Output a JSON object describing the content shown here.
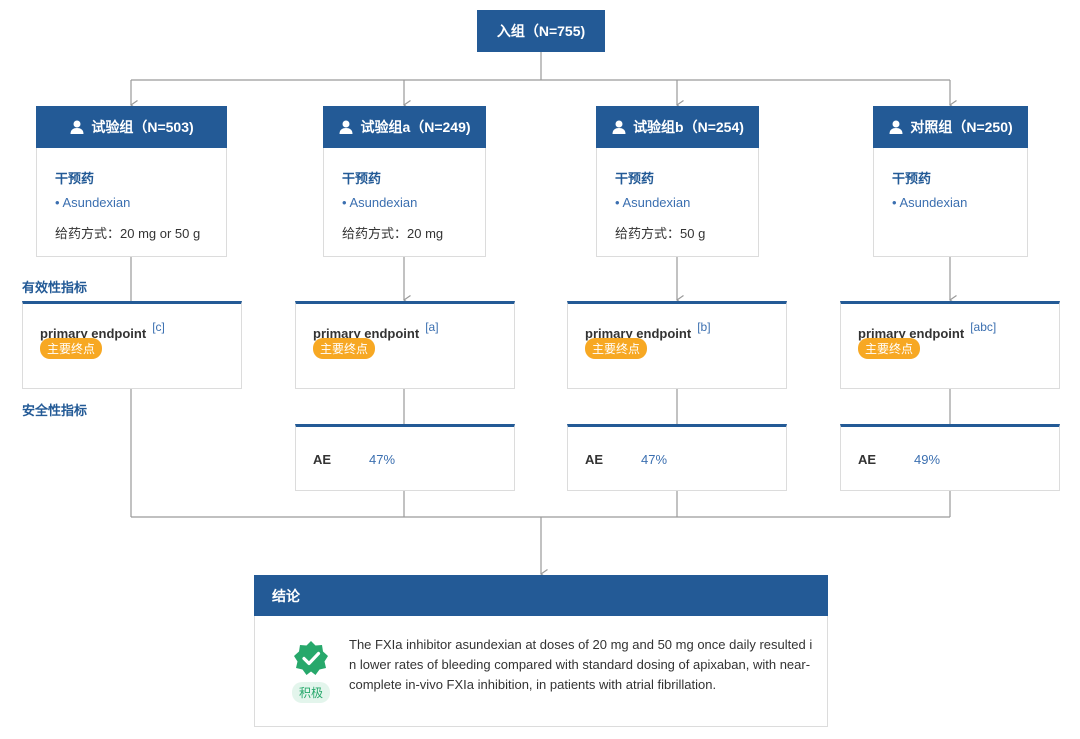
{
  "enrollment": {
    "label": "入组（N=755)"
  },
  "side_labels": {
    "efficacy": "有效性指标",
    "safety": "安全性指标"
  },
  "arms": [
    {
      "title": "试验组（N=503)",
      "drug_title": "干预药",
      "drug": "• Asundexian",
      "dose": "给药方式：20 mg or 50 g",
      "endpoint": "primary endpoint",
      "endpoint_sup": "[c]",
      "endpoint_badge": "主要终点"
    },
    {
      "title": "试验组a（N=249)",
      "drug_title": "干预药",
      "drug": "• Asundexian",
      "dose": "给药方式：20 mg",
      "endpoint": "primary endpoint",
      "endpoint_sup": "[a]",
      "endpoint_badge": "主要终点",
      "ae_label": "AE",
      "ae_value": "47%"
    },
    {
      "title": "试验组b（N=254)",
      "drug_title": "干预药",
      "drug": "• Asundexian",
      "dose": "给药方式：50 g",
      "endpoint": "primary endpoint",
      "endpoint_sup": "[b]",
      "endpoint_badge": "主要终点",
      "ae_label": "AE",
      "ae_value": "47%"
    },
    {
      "title": "对照组（N=250)",
      "drug_title": "干预药",
      "drug": "• Asundexian",
      "endpoint": "primary endpoint",
      "endpoint_sup": "[abc]",
      "endpoint_badge": "主要终点",
      "ae_label": "AE",
      "ae_value": "49%"
    }
  ],
  "conclusion": {
    "title": "结论",
    "tag": "积极",
    "icon": "check-badge-icon",
    "text": "The FXIa inhibitor asundexian at doses of 20 mg and 50 mg once daily resulted in lower rates of bleeding compared with standard dosing of apixaban, with near-complete in-vivo FXIa inhibition, in patients with atrial fibrillation."
  },
  "colors": {
    "primary": "#235a96",
    "link": "#3b6fb0",
    "badge": "#f7a823",
    "positive": "#27a86b",
    "line": "#9a9a9a"
  }
}
